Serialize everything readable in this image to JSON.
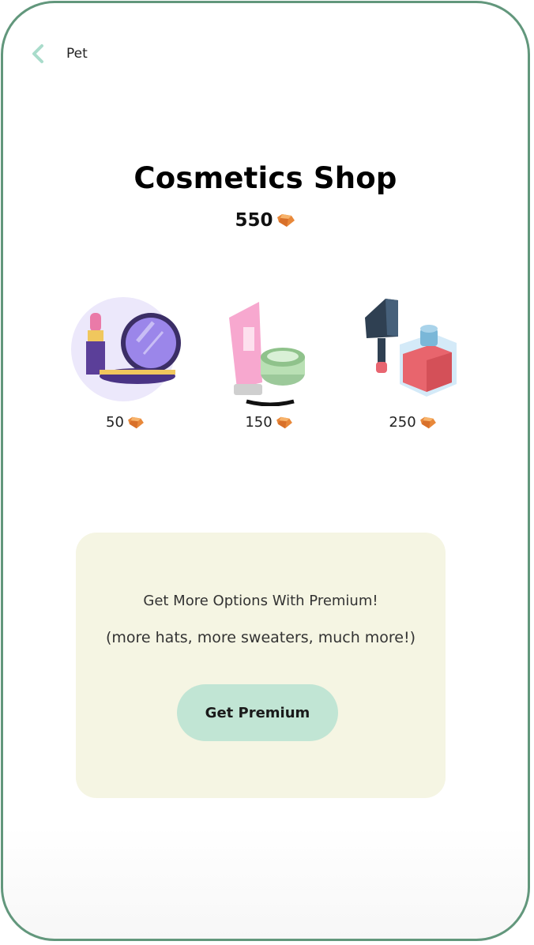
{
  "header": {
    "title": "Pet",
    "back_icon": "chevron-left-icon"
  },
  "shop": {
    "title": "Cosmetics Shop",
    "balance": "550",
    "currency_icon": "gem-icon"
  },
  "items": [
    {
      "name": "makeup-set",
      "price": "50"
    },
    {
      "name": "cream-tube-and-jar",
      "price": "150"
    },
    {
      "name": "nail-polish-bottle",
      "price": "250"
    }
  ],
  "premium": {
    "headline": "Get More Options With Premium!",
    "subtext": "(more hats, more sweaters, much more!)",
    "button_label": "Get Premium"
  },
  "colors": {
    "frame": "#62977c",
    "accent": "#c1e5d4",
    "card_bg": "#f5f5e3",
    "gem": "#e8883a"
  }
}
